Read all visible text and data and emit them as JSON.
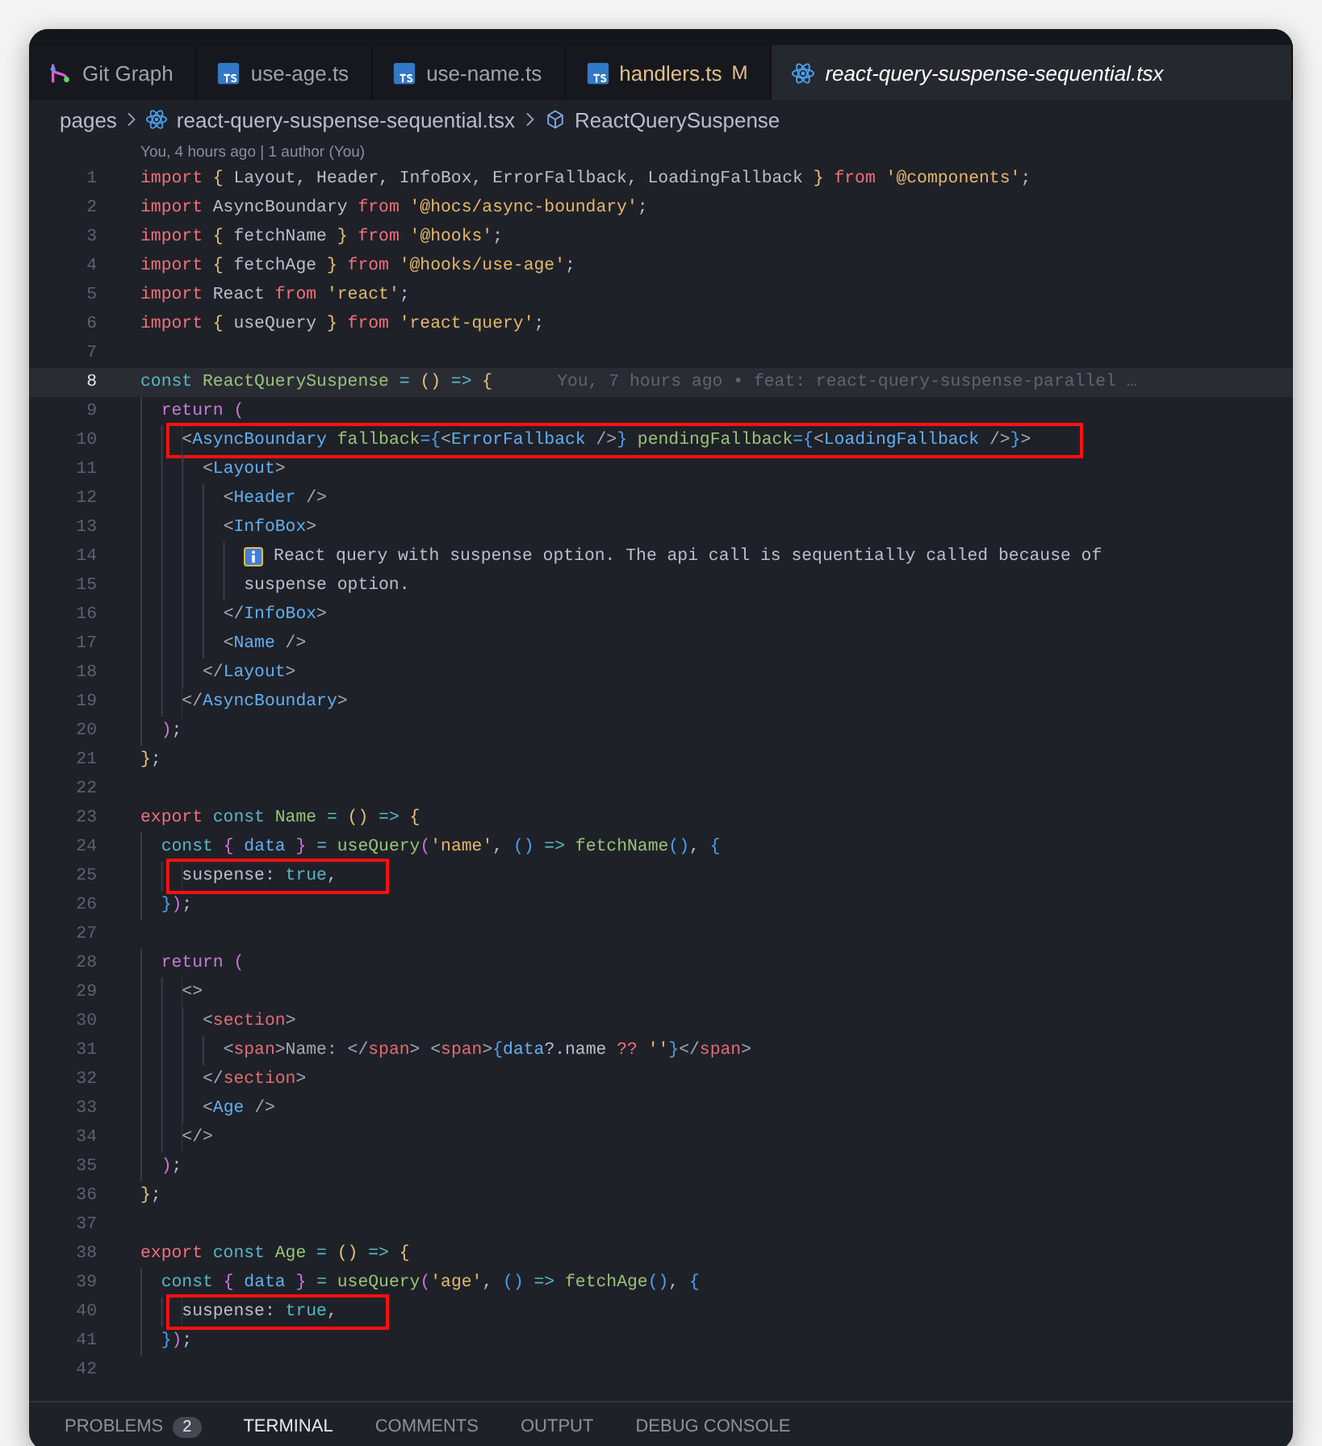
{
  "tabs": [
    {
      "label": "Git Graph",
      "kind": "git",
      "selected": false,
      "modified": false
    },
    {
      "label": "use-age.ts",
      "kind": "ts",
      "selected": false,
      "modified": false
    },
    {
      "label": "use-name.ts",
      "kind": "ts",
      "selected": false,
      "modified": false
    },
    {
      "label": "handlers.ts",
      "kind": "ts",
      "selected": false,
      "modified": true,
      "status": "M"
    },
    {
      "label": "react-query-suspense-sequential.tsx",
      "kind": "react",
      "selected": true,
      "modified": false
    }
  ],
  "breadcrumb": [
    {
      "label": "pages",
      "kind": "folder"
    },
    {
      "label": "react-query-suspense-sequential.tsx",
      "kind": "react"
    },
    {
      "label": "ReactQuerySuspense",
      "kind": "symbol"
    }
  ],
  "code_lens": "You, 4 hours ago | 1 author (You)",
  "lines": [
    {
      "number": "1",
      "current": false,
      "boxed": false,
      "tokens": [
        {
          "text": "import",
          "kind": "kw"
        },
        {
          "text": " {",
          "kind": "br"
        },
        {
          "text": " Layout, Header, InfoBox, ErrorFallback, LoadingFallback ",
          "kind": "tx"
        },
        {
          "text": "}",
          "kind": "br"
        },
        {
          "text": " from ",
          "kind": "kw"
        },
        {
          "text": "'@components'",
          "kind": "str"
        },
        {
          "text": ";",
          "kind": "tx"
        }
      ]
    },
    {
      "number": "2",
      "current": false,
      "boxed": false,
      "tokens": [
        {
          "text": "import",
          "kind": "kw"
        },
        {
          "text": " AsyncBoundary ",
          "kind": "tx"
        },
        {
          "text": "from",
          "kind": "kw"
        },
        {
          "text": " '@hocs/async-boundary'",
          "kind": "str"
        },
        {
          "text": ";",
          "kind": "tx"
        }
      ]
    },
    {
      "number": "3",
      "current": false,
      "boxed": false,
      "tokens": [
        {
          "text": "import",
          "kind": "kw"
        },
        {
          "text": " {",
          "kind": "br"
        },
        {
          "text": " fetchName ",
          "kind": "tx"
        },
        {
          "text": "}",
          "kind": "br"
        },
        {
          "text": " from ",
          "kind": "kw"
        },
        {
          "text": "'@hooks'",
          "kind": "str"
        },
        {
          "text": ";",
          "kind": "tx"
        }
      ]
    },
    {
      "number": "4",
      "current": false,
      "boxed": false,
      "tokens": [
        {
          "text": "import",
          "kind": "kw"
        },
        {
          "text": " {",
          "kind": "br"
        },
        {
          "text": " fetchAge ",
          "kind": "tx"
        },
        {
          "text": "}",
          "kind": "br"
        },
        {
          "text": " from ",
          "kind": "kw"
        },
        {
          "text": "'@hooks/use-age'",
          "kind": "str"
        },
        {
          "text": ";",
          "kind": "tx"
        }
      ]
    },
    {
      "number": "5",
      "current": false,
      "boxed": false,
      "tokens": [
        {
          "text": "import",
          "kind": "kw"
        },
        {
          "text": " React ",
          "kind": "tx"
        },
        {
          "text": "from",
          "kind": "kw"
        },
        {
          "text": " 'react'",
          "kind": "str"
        },
        {
          "text": ";",
          "kind": "tx"
        }
      ]
    },
    {
      "number": "6",
      "current": false,
      "boxed": false,
      "tokens": [
        {
          "text": "import",
          "kind": "kw"
        },
        {
          "text": " {",
          "kind": "br"
        },
        {
          "text": " useQuery ",
          "kind": "tx"
        },
        {
          "text": "}",
          "kind": "br"
        },
        {
          "text": " from ",
          "kind": "kw"
        },
        {
          "text": "'react-query'",
          "kind": "str"
        },
        {
          "text": ";",
          "kind": "tx"
        }
      ]
    },
    {
      "number": "7",
      "current": false
    },
    {
      "number": "8",
      "current": true,
      "boxed": false,
      "blame": "You, 7 hours ago • feat: react-query-suspense-parallel …",
      "tokens": [
        {
          "text": "const",
          "kind": "st"
        },
        {
          "text": " ReactQuerySuspense",
          "kind": "fn"
        },
        {
          "text": " = ",
          "kind": "st"
        },
        {
          "text": "()",
          "kind": "br"
        },
        {
          "text": " => ",
          "kind": "st"
        },
        {
          "text": "{",
          "kind": "br"
        }
      ]
    },
    {
      "number": "9",
      "current": false,
      "boxed": false,
      "tokens": [
        {
          "text": "  return (",
          "kind": "ret"
        }
      ]
    },
    {
      "number": "10",
      "current": false,
      "boxed": true,
      "tokens": [
        {
          "text": "    <",
          "kind": "pun"
        },
        {
          "text": "AsyncBoundary",
          "kind": "tag"
        },
        {
          "text": " fallback",
          "kind": "fn"
        },
        {
          "text": "={",
          "kind": "jb"
        },
        {
          "text": "<",
          "kind": "pun"
        },
        {
          "text": "ErrorFallback",
          "kind": "tag"
        },
        {
          "text": " />",
          "kind": "pun"
        },
        {
          "text": "}",
          "kind": "jb"
        },
        {
          "text": " pendingFallback",
          "kind": "fn"
        },
        {
          "text": "={",
          "kind": "jb"
        },
        {
          "text": "<",
          "kind": "pun"
        },
        {
          "text": "LoadingFallback",
          "kind": "tag"
        },
        {
          "text": " />",
          "kind": "pun"
        },
        {
          "text": "}",
          "kind": "jb"
        },
        {
          "text": ">",
          "kind": "pun"
        }
      ]
    },
    {
      "number": "11",
      "current": false,
      "boxed": false,
      "tokens": [
        {
          "text": "      <",
          "kind": "pun"
        },
        {
          "text": "Layout",
          "kind": "tag"
        },
        {
          "text": ">",
          "kind": "pun"
        }
      ]
    },
    {
      "number": "12",
      "current": false,
      "boxed": false,
      "tokens": [
        {
          "text": "        <",
          "kind": "pun"
        },
        {
          "text": "Header",
          "kind": "tag"
        },
        {
          "text": " />",
          "kind": "pun"
        }
      ]
    },
    {
      "number": "13",
      "current": false,
      "boxed": false,
      "tokens": [
        {
          "text": "        <",
          "kind": "pun"
        },
        {
          "text": "InfoBox",
          "kind": "tag"
        },
        {
          "text": ">",
          "kind": "pun"
        }
      ]
    },
    {
      "number": "14",
      "current": false,
      "boxed": false,
      "tokens": [
        {
          "kind": "info"
        },
        {
          "text": " React query with suspense option. The api call is sequentially called because of",
          "kind": "tx"
        }
      ]
    },
    {
      "number": "15",
      "current": false,
      "boxed": false,
      "tokens": [
        {
          "text": "          suspense option.",
          "kind": "tx"
        }
      ]
    },
    {
      "number": "16",
      "current": false,
      "boxed": false,
      "tokens": [
        {
          "text": "        </",
          "kind": "pun"
        },
        {
          "text": "InfoBox",
          "kind": "tag"
        },
        {
          "text": ">",
          "kind": "pun"
        }
      ]
    },
    {
      "number": "17",
      "current": false,
      "boxed": false,
      "tokens": [
        {
          "text": "        <",
          "kind": "pun"
        },
        {
          "text": "Name",
          "kind": "tag"
        },
        {
          "text": " />",
          "kind": "pun"
        }
      ]
    },
    {
      "number": "18",
      "current": false,
      "boxed": false,
      "tokens": [
        {
          "text": "      </",
          "kind": "pun"
        },
        {
          "text": "Layout",
          "kind": "tag"
        },
        {
          "text": ">",
          "kind": "pun"
        }
      ]
    },
    {
      "number": "19",
      "current": false,
      "boxed": false,
      "tokens": [
        {
          "text": "    </",
          "kind": "pun"
        },
        {
          "text": "AsyncBoundary",
          "kind": "tag"
        },
        {
          "text": ">",
          "kind": "pun"
        }
      ]
    },
    {
      "number": "20",
      "current": false,
      "boxed": false,
      "tokens": [
        {
          "text": "  )",
          "kind": "ret"
        },
        {
          "text": ";",
          "kind": "tx"
        }
      ]
    },
    {
      "number": "21",
      "current": false,
      "boxed": false,
      "tokens": [
        {
          "text": "}",
          "kind": "br"
        },
        {
          "text": ";",
          "kind": "tx"
        }
      ]
    },
    {
      "number": "22",
      "current": false
    },
    {
      "number": "23",
      "current": false,
      "boxed": false,
      "tokens": [
        {
          "text": "export",
          "kind": "kw"
        },
        {
          "text": " const",
          "kind": "st"
        },
        {
          "text": " Name",
          "kind": "fn"
        },
        {
          "text": " = ",
          "kind": "st"
        },
        {
          "text": "()",
          "kind": "br"
        },
        {
          "text": " => ",
          "kind": "st"
        },
        {
          "text": "{",
          "kind": "br"
        }
      ]
    },
    {
      "number": "24",
      "current": false,
      "boxed": false,
      "tokens": [
        {
          "text": "  const",
          "kind": "st"
        },
        {
          "text": " { ",
          "kind": "ret"
        },
        {
          "text": "data",
          "kind": "tag"
        },
        {
          "text": " } ",
          "kind": "ret"
        },
        {
          "text": "= ",
          "kind": "st"
        },
        {
          "text": "useQuery",
          "kind": "fn"
        },
        {
          "text": "(",
          "kind": "ret"
        },
        {
          "text": "'name'",
          "kind": "str"
        },
        {
          "text": ", ",
          "kind": "tx"
        },
        {
          "text": "()",
          "kind": "jb"
        },
        {
          "text": " => ",
          "kind": "st"
        },
        {
          "text": "fetchName",
          "kind": "fn"
        },
        {
          "text": "()",
          "kind": "jb"
        },
        {
          "text": ", ",
          "kind": "tx"
        },
        {
          "text": "{",
          "kind": "jb"
        }
      ]
    },
    {
      "number": "25",
      "current": false,
      "boxed": true,
      "tokens": [
        {
          "text": "    suspense: ",
          "kind": "tx"
        },
        {
          "text": "true",
          "kind": "st"
        },
        {
          "text": ",",
          "kind": "tx"
        }
      ]
    },
    {
      "number": "26",
      "current": false,
      "boxed": false,
      "tokens": [
        {
          "text": "  }",
          "kind": "jb"
        },
        {
          "text": ")",
          "kind": "ret"
        },
        {
          "text": ";",
          "kind": "tx"
        }
      ]
    },
    {
      "number": "27",
      "current": false
    },
    {
      "number": "28",
      "current": false,
      "boxed": false,
      "tokens": [
        {
          "text": "  return (",
          "kind": "ret"
        }
      ]
    },
    {
      "number": "29",
      "current": false,
      "boxed": false,
      "tokens": [
        {
          "text": "    <>",
          "kind": "pun"
        }
      ]
    },
    {
      "number": "30",
      "current": false,
      "boxed": false,
      "tokens": [
        {
          "text": "      <",
          "kind": "pun"
        },
        {
          "text": "section",
          "kind": "htag"
        },
        {
          "text": ">",
          "kind": "pun"
        }
      ]
    },
    {
      "number": "31",
      "current": false,
      "boxed": false,
      "tokens": [
        {
          "text": "        <",
          "kind": "pun"
        },
        {
          "text": "span",
          "kind": "htag"
        },
        {
          "text": ">Name: </",
          "kind": "pun"
        },
        {
          "text": "span",
          "kind": "htag"
        },
        {
          "text": "> <",
          "kind": "pun"
        },
        {
          "text": "span",
          "kind": "htag"
        },
        {
          "text": ">",
          "kind": "pun"
        },
        {
          "text": "{",
          "kind": "jb"
        },
        {
          "text": "data",
          "kind": "tag"
        },
        {
          "text": "?.name ",
          "kind": "tx"
        },
        {
          "text": "??",
          "kind": "kw"
        },
        {
          "text": " ''",
          "kind": "str"
        },
        {
          "text": "}",
          "kind": "jb"
        },
        {
          "text": "</",
          "kind": "pun"
        },
        {
          "text": "span",
          "kind": "htag"
        },
        {
          "text": ">",
          "kind": "pun"
        }
      ]
    },
    {
      "number": "32",
      "current": false,
      "boxed": false,
      "tokens": [
        {
          "text": "      </",
          "kind": "pun"
        },
        {
          "text": "section",
          "kind": "htag"
        },
        {
          "text": ">",
          "kind": "pun"
        }
      ]
    },
    {
      "number": "33",
      "current": false,
      "boxed": false,
      "tokens": [
        {
          "text": "      <",
          "kind": "pun"
        },
        {
          "text": "Age",
          "kind": "tag"
        },
        {
          "text": " />",
          "kind": "pun"
        }
      ]
    },
    {
      "number": "34",
      "current": false,
      "boxed": false,
      "tokens": [
        {
          "text": "    </>",
          "kind": "pun"
        }
      ]
    },
    {
      "number": "35",
      "current": false,
      "boxed": false,
      "tokens": [
        {
          "text": "  )",
          "kind": "ret"
        },
        {
          "text": ";",
          "kind": "tx"
        }
      ]
    },
    {
      "number": "36",
      "current": false,
      "boxed": false,
      "tokens": [
        {
          "text": "}",
          "kind": "br"
        },
        {
          "text": ";",
          "kind": "tx"
        }
      ]
    },
    {
      "number": "37",
      "current": false
    },
    {
      "number": "38",
      "current": false,
      "boxed": false,
      "tokens": [
        {
          "text": "export",
          "kind": "kw"
        },
        {
          "text": " const",
          "kind": "st"
        },
        {
          "text": " Age",
          "kind": "fn"
        },
        {
          "text": " = ",
          "kind": "st"
        },
        {
          "text": "()",
          "kind": "br"
        },
        {
          "text": " => ",
          "kind": "st"
        },
        {
          "text": "{",
          "kind": "br"
        }
      ]
    },
    {
      "number": "39",
      "current": false,
      "boxed": false,
      "tokens": [
        {
          "text": "  const",
          "kind": "st"
        },
        {
          "text": " { ",
          "kind": "ret"
        },
        {
          "text": "data",
          "kind": "tag"
        },
        {
          "text": " } ",
          "kind": "ret"
        },
        {
          "text": "= ",
          "kind": "st"
        },
        {
          "text": "useQuery",
          "kind": "fn"
        },
        {
          "text": "(",
          "kind": "ret"
        },
        {
          "text": "'age'",
          "kind": "str"
        },
        {
          "text": ", ",
          "kind": "tx"
        },
        {
          "text": "()",
          "kind": "jb"
        },
        {
          "text": " => ",
          "kind": "st"
        },
        {
          "text": "fetchAge",
          "kind": "fn"
        },
        {
          "text": "()",
          "kind": "jb"
        },
        {
          "text": ", ",
          "kind": "tx"
        },
        {
          "text": "{",
          "kind": "jb"
        }
      ]
    },
    {
      "number": "40",
      "current": false,
      "boxed": true,
      "tokens": [
        {
          "text": "    suspense: ",
          "kind": "tx"
        },
        {
          "text": "true",
          "kind": "st"
        },
        {
          "text": ",",
          "kind": "tx"
        }
      ]
    },
    {
      "number": "41",
      "current": false,
      "boxed": false,
      "tokens": [
        {
          "text": "  }",
          "kind": "jb"
        },
        {
          "text": ")",
          "kind": "ret"
        },
        {
          "text": ";",
          "kind": "tx"
        }
      ]
    },
    {
      "number": "42",
      "current": false
    }
  ],
  "panel_tabs": [
    {
      "label": "PROBLEMS",
      "badge": "2",
      "selected": false
    },
    {
      "label": "TERMINAL",
      "selected": true
    },
    {
      "label": "COMMENTS",
      "selected": false
    },
    {
      "label": "OUTPUT",
      "selected": false
    },
    {
      "label": "DEBUG CONSOLE",
      "selected": false
    }
  ]
}
